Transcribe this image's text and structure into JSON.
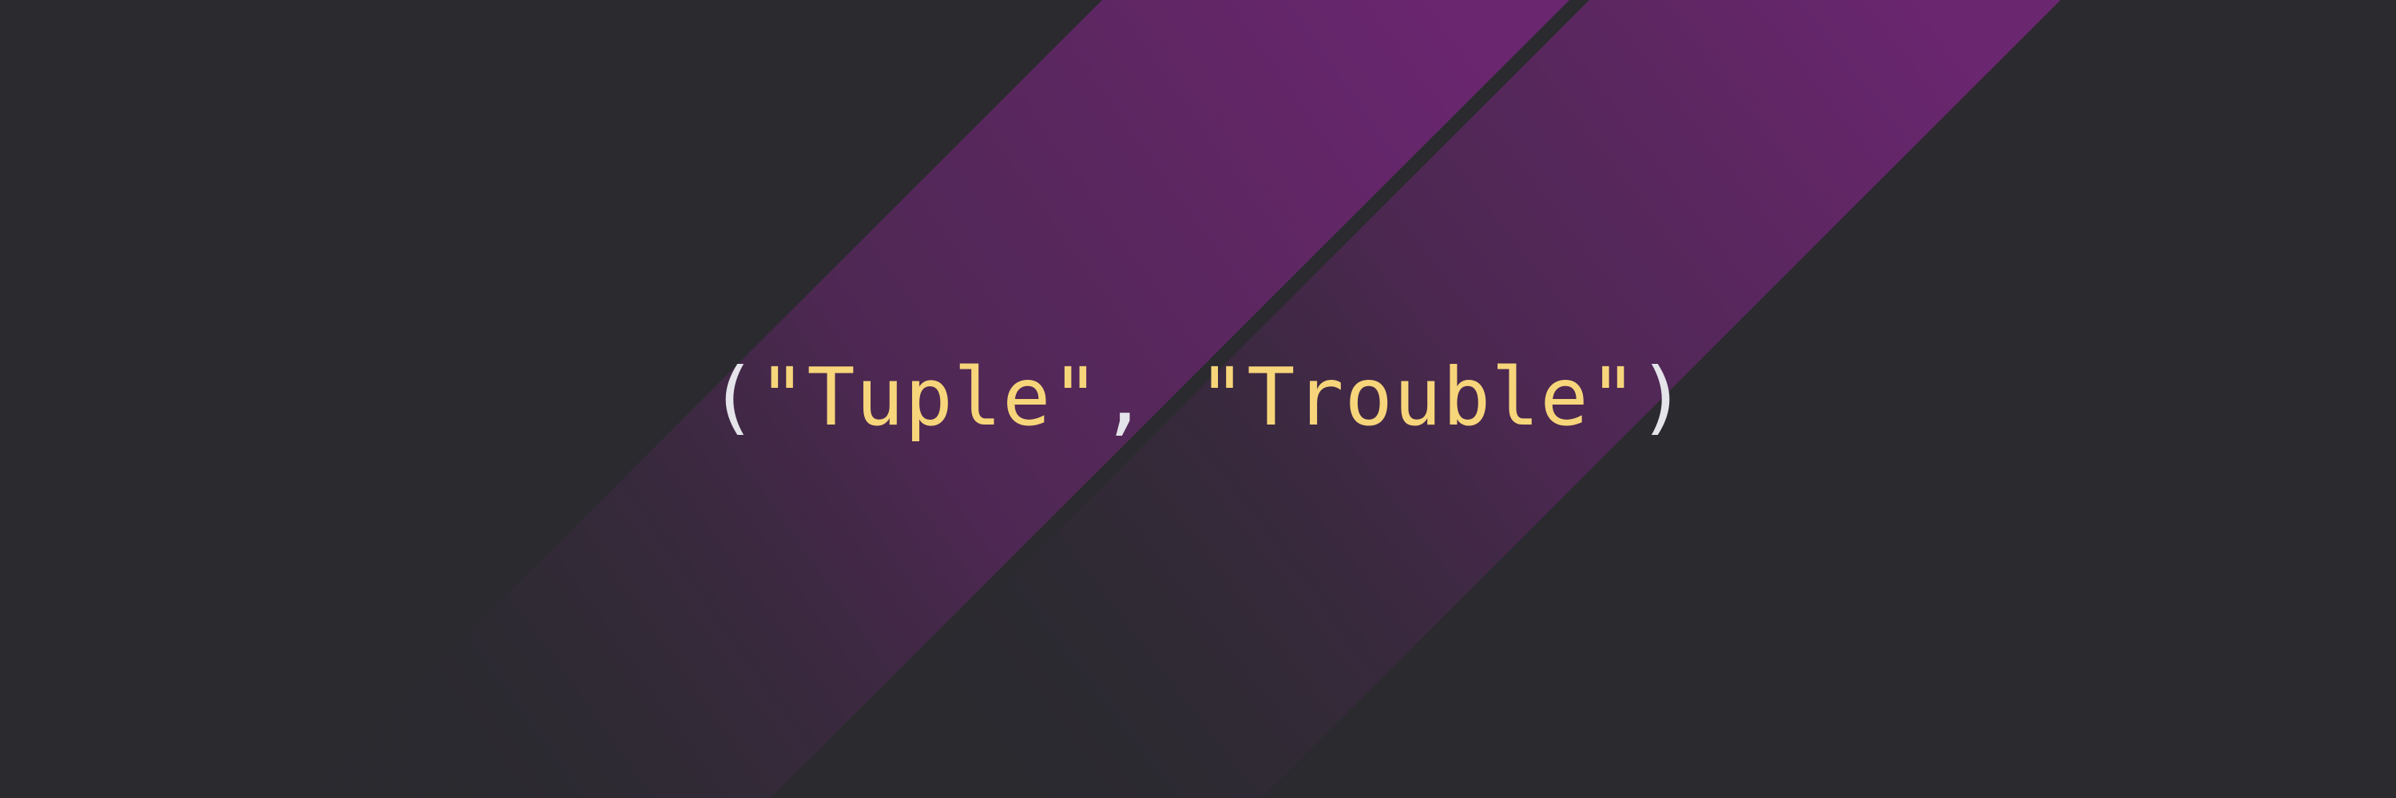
{
  "colors": {
    "background": "#2a2a2f",
    "stripe_bright": "#6b2670",
    "stripe_dark": "#2d2a31",
    "punctuation": "#e4e4ea",
    "string": "#f7d57a"
  },
  "code": {
    "open_paren": "(",
    "string_1": "\"Tuple\"",
    "separator": ", ",
    "string_2": "\"Trouble\"",
    "close_paren": ")"
  }
}
